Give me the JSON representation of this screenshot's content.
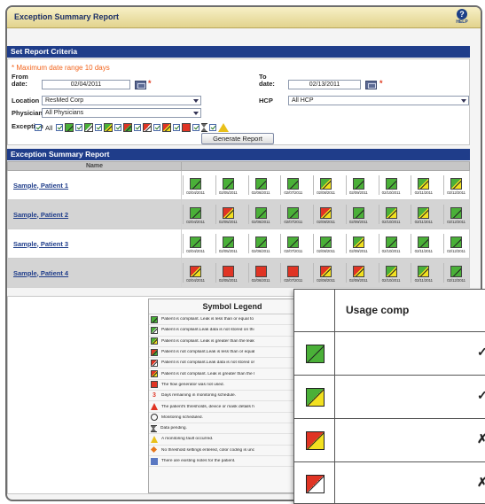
{
  "window": {
    "title": "Exception Summary Report",
    "help_label": "HELP",
    "help_glyph": "?"
  },
  "criteria": {
    "section_title": "Set Report Criteria",
    "warning": "* Maximum date range 10 days",
    "from_label": "From date:",
    "from_value": "02/04/2011",
    "to_label": "To date:",
    "to_value": "02/13/2011",
    "required_mark": "*",
    "location_label": "Location",
    "location_value": "ResMed Corp",
    "hcp_label": "HCP",
    "hcp_value": "All HCP",
    "physician_label": "Physician",
    "physician_value": "All Physicians",
    "exception_label": "Exception",
    "all_label": "All",
    "generate_button": "Generate Report"
  },
  "report": {
    "section_title": "Exception Summary Report",
    "name_header": "Name",
    "dates": [
      "02/04/2011",
      "02/05/2011",
      "02/06/2011",
      "02/07/2011",
      "02/08/2011",
      "02/09/2011",
      "02/10/2011",
      "02/11/2011",
      "02/12/2011"
    ],
    "patients": [
      {
        "name": "Sample, Patient 1",
        "days": [
          "green",
          "green",
          "green",
          "green",
          "gy",
          "green",
          "green",
          "gy",
          "gy"
        ]
      },
      {
        "name": "Sample, Patient 2",
        "days": [
          "green",
          "ry",
          "green",
          "green",
          "ry",
          "green",
          "gy",
          "gy",
          "green"
        ]
      },
      {
        "name": "Sample, Patient 3",
        "days": [
          "green",
          "green",
          "green",
          "green",
          "green",
          "gy",
          "green",
          "green",
          "green"
        ]
      },
      {
        "name": "Sample, Patient 4",
        "days": [
          "ry",
          "red",
          "red",
          "red",
          "ry",
          "ry",
          "gy",
          "gy",
          "green"
        ]
      }
    ]
  },
  "legend": {
    "title": "Symbol Legend",
    "items": [
      "Patient is compliant. Leak is less than or equal to",
      "Patient is compliant.Leak data is not stored on thi",
      "Patient is compliant. Leak is greater than the leak",
      "Patient is not compliant.Leak is less than or equal",
      "Patient is not compliant.Leak data is not stored or",
      "Patient is not compliant. Leak is greater than the l",
      "The flow generator was not used.",
      "Days remaining in monitoring schedule.",
      "The patient's thresholds, device or mask details h",
      "Monitoring scheduled.",
      "Data pending.",
      "A monitoring fault occurred.",
      "No threshold settings entered, color coding is unc",
      "There are existing notes for the patient."
    ],
    "three_glyph": "3"
  },
  "popup": {
    "header": "Usage comp",
    "rows": [
      {
        "icon": "green",
        "mark": "✓"
      },
      {
        "icon": "gy",
        "mark": "✓"
      },
      {
        "icon": "ry",
        "mark": "✗"
      },
      {
        "icon": "rw",
        "mark": "✗"
      }
    ]
  },
  "colors": {
    "header_blue": "#1f3d8a",
    "compliant_green": "#4ab038",
    "leak_yellow": "#f2e020",
    "noncompliant_red": "#e03424"
  }
}
